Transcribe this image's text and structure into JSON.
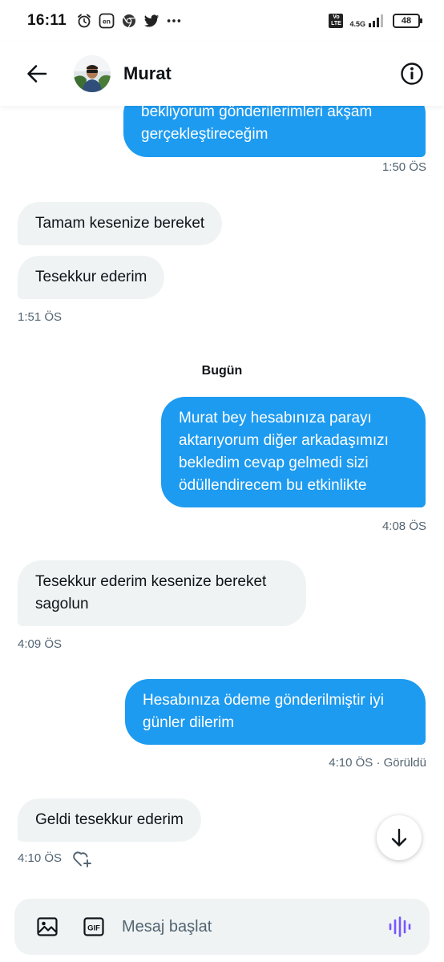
{
  "status_bar": {
    "time": "16:11",
    "network": "4.5G",
    "volte": "Vo LTE",
    "battery": "48"
  },
  "header": {
    "contact_name": "Murat"
  },
  "messages": [
    {
      "direction": "out",
      "lines": [
        "bekliyorum gönderilerimleri akşam",
        "gerçekleştireceğim"
      ],
      "meta": "1:50 ÖS"
    },
    {
      "direction": "in",
      "lines": [
        "Tamam kesenize bereket"
      ]
    },
    {
      "direction": "in",
      "lines": [
        "Tesekkur ederim"
      ],
      "meta": "1:51 ÖS"
    },
    {
      "direction": "out",
      "lines": [
        "Murat bey hesabınıza parayı",
        "aktarıyorum diğer arkadaşımızı",
        "bekledim cevap gelmedi sizi",
        "ödüllendirecem bu etkinlikte"
      ],
      "meta": "4:08 ÖS"
    },
    {
      "direction": "in",
      "lines": [
        "Tesekkur ederim kesenize bereket",
        "sagolun"
      ],
      "meta": "4:09 ÖS"
    },
    {
      "direction": "out",
      "lines": [
        "Hesabınıza ödeme gönderilmiştir iyi",
        "günler dilerim"
      ],
      "meta": "4:10 ÖS · Görüldü"
    },
    {
      "direction": "in",
      "lines": [
        "Geldi tesekkur ederim"
      ],
      "meta": "4:10 ÖS"
    }
  ],
  "day_separator": "Bugün",
  "composer": {
    "placeholder": "Mesaj başlat",
    "gif_label": "GIF"
  },
  "colors": {
    "outgoing_bubble": "#1d9bf0",
    "incoming_bubble": "#eff3f4",
    "voice_icon": "#7856ff"
  }
}
